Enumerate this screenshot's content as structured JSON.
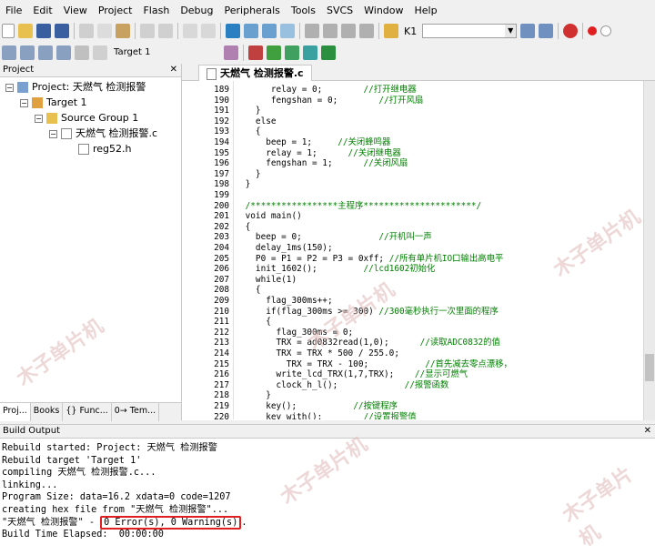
{
  "menu": [
    "File",
    "Edit",
    "View",
    "Project",
    "Flash",
    "Debug",
    "Peripherals",
    "Tools",
    "SVCS",
    "Window",
    "Help"
  ],
  "toolbar": {
    "target_k1": "K1",
    "target_select": "Target 1"
  },
  "project_panel": {
    "title": "Project",
    "project_label": "Project: 天燃气 检测报警",
    "target": "Target 1",
    "source_group": "Source Group 1",
    "source_file": "天燃气 检测报警.c",
    "header_file": "reg52.h",
    "tabs": [
      "Proj...",
      "Books",
      "{} Func...",
      "0→ Tem..."
    ]
  },
  "editor": {
    "tab": "天燃气 检测报警.c",
    "lines": [
      {
        "n": "189",
        "t": "      relay = 0;        //打开继电器"
      },
      {
        "n": "190",
        "t": "      fengshan = 0;        //打开风扇"
      },
      {
        "n": "191",
        "t": "   }"
      },
      {
        "n": "192",
        "t": "   else"
      },
      {
        "n": "193",
        "t": "   {"
      },
      {
        "n": "194",
        "t": "     beep = 1;     //关闭蜂鸣器"
      },
      {
        "n": "195",
        "t": "     relay = 1;      //关闭继电器"
      },
      {
        "n": "196",
        "t": "     fengshan = 1;      //关闭风扇"
      },
      {
        "n": "197",
        "t": "   }"
      },
      {
        "n": "198",
        "t": " }"
      },
      {
        "n": "199",
        "t": ""
      },
      {
        "n": "200",
        "t": " /*****************主程序**********************/"
      },
      {
        "n": "201",
        "t": " void main()"
      },
      {
        "n": "202",
        "t": " {"
      },
      {
        "n": "203",
        "t": "   beep = 0;               //开机叫一声"
      },
      {
        "n": "204",
        "t": "   delay_1ms(150);"
      },
      {
        "n": "205",
        "t": "   P0 = P1 = P2 = P3 = 0xff; //所有单片机IO口输出高电平"
      },
      {
        "n": "206",
        "t": "   init_1602();         //lcd1602初始化"
      },
      {
        "n": "207",
        "t": "   while(1)"
      },
      {
        "n": "208",
        "t": "   {"
      },
      {
        "n": "209",
        "t": "     flag_300ms++;"
      },
      {
        "n": "210",
        "t": "     if(flag_300ms >= 300) //300毫秒执行一次里面的程序"
      },
      {
        "n": "211",
        "t": "     {"
      },
      {
        "n": "212",
        "t": "       flag_300ms = 0;"
      },
      {
        "n": "213",
        "t": "       TRX = ad0832read(1,0);      //读取ADC0832的值"
      },
      {
        "n": "214",
        "t": "       TRX = TRX * 500 / 255.0;"
      },
      {
        "n": "215",
        "t": "         TRX = TRX - 100;           //首先减去零点漂移，"
      },
      {
        "n": "216",
        "t": "       write_lcd_TRX(1,7,TRX);    //显示可燃气"
      },
      {
        "n": "217",
        "t": "       clock_h_l();             //报警函数"
      },
      {
        "n": "218",
        "t": "     }"
      },
      {
        "n": "219",
        "t": "     key();           //按键程序"
      },
      {
        "n": "220",
        "t": "     key_with();        //设置报警值"
      }
    ]
  },
  "build_output": {
    "title": "Build Output",
    "lines": [
      "Rebuild started: Project: 天燃气 检测报警",
      "Rebuild target 'Target 1'",
      "compiling 天燃气 检测报警.c...",
      "linking...",
      "Program Size: data=16.2 xdata=0 code=1207",
      "creating hex file from \"天燃气 检测报警\"..."
    ],
    "result_prefix": "\"天燃气 检测报警\" - ",
    "result_highlight": "0 Error(s), 0 Warning(s)",
    "result_suffix": ".",
    "elapsed": "Build Time Elapsed:  00:00:00"
  },
  "watermark": "木子单片机",
  "colors": {
    "keyword": "#0000ff",
    "comment": "#008000",
    "number": "#800080",
    "highlight_border": "#e02020"
  }
}
